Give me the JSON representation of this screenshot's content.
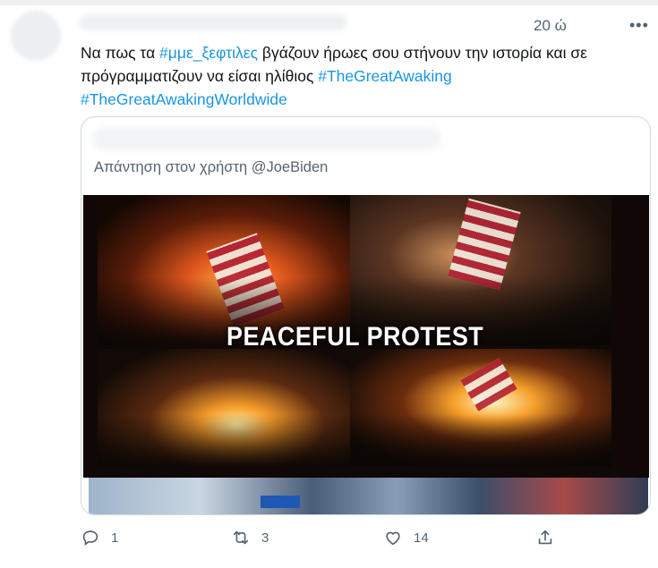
{
  "tweet": {
    "time": "20 ώ",
    "more_label": "•••",
    "text_parts": {
      "p1": "Να πως τα ",
      "tag1": "#μμε_ξεφτιλες",
      "p2": " βγάζουν ήρωες σου στήνουν την ιστορία και σε πρόγραμματιζουν να είσαι ηλίθιος ",
      "tag2": "#TheGreatAwaking",
      "p3": " ",
      "tag3": "#TheGreatAwakingWorldwide"
    }
  },
  "quote": {
    "reply_line": "Απάντηση στον χρήστη @JoeBiden",
    "image_caption": "PEACEFUL PROTEST"
  },
  "actions": {
    "reply": {
      "icon": "reply-icon",
      "count": "1"
    },
    "retweet": {
      "icon": "retweet-icon",
      "count": "3"
    },
    "like": {
      "icon": "heart-icon",
      "count": "14"
    },
    "share": {
      "icon": "share-icon"
    }
  },
  "colors": {
    "hashtag": "#1b95e0",
    "secondary_text": "#536471",
    "border": "#cfd9de"
  }
}
